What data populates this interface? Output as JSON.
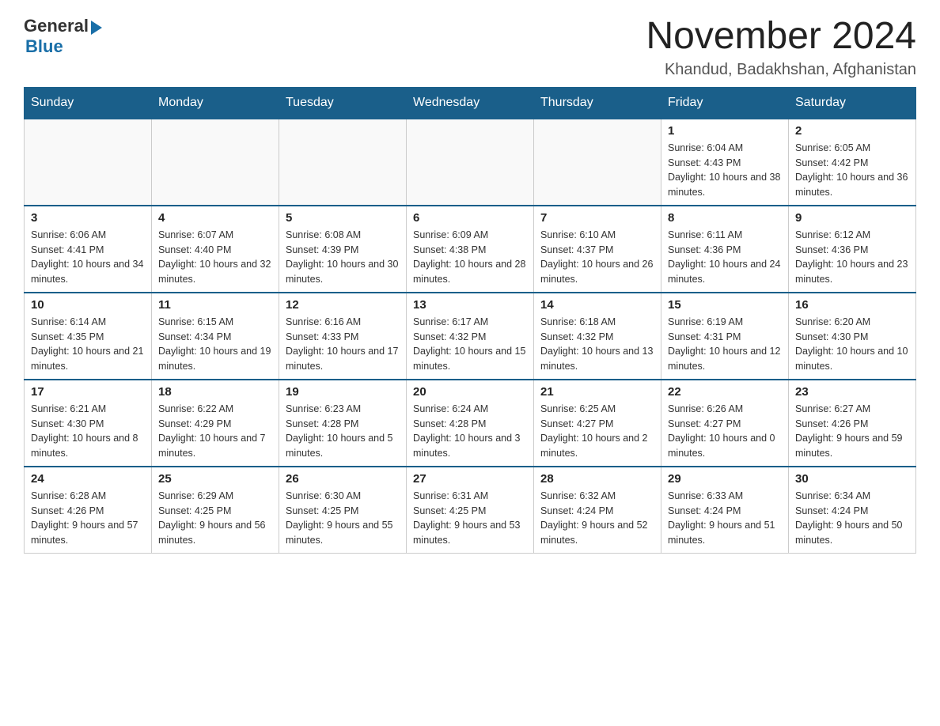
{
  "logo": {
    "general_text": "General",
    "blue_text": "Blue"
  },
  "title": "November 2024",
  "subtitle": "Khandud, Badakhshan, Afghanistan",
  "days_of_week": [
    "Sunday",
    "Monday",
    "Tuesday",
    "Wednesday",
    "Thursday",
    "Friday",
    "Saturday"
  ],
  "weeks": [
    {
      "days": [
        {
          "number": "",
          "info": ""
        },
        {
          "number": "",
          "info": ""
        },
        {
          "number": "",
          "info": ""
        },
        {
          "number": "",
          "info": ""
        },
        {
          "number": "",
          "info": ""
        },
        {
          "number": "1",
          "info": "Sunrise: 6:04 AM\nSunset: 4:43 PM\nDaylight: 10 hours and 38 minutes."
        },
        {
          "number": "2",
          "info": "Sunrise: 6:05 AM\nSunset: 4:42 PM\nDaylight: 10 hours and 36 minutes."
        }
      ]
    },
    {
      "days": [
        {
          "number": "3",
          "info": "Sunrise: 6:06 AM\nSunset: 4:41 PM\nDaylight: 10 hours and 34 minutes."
        },
        {
          "number": "4",
          "info": "Sunrise: 6:07 AM\nSunset: 4:40 PM\nDaylight: 10 hours and 32 minutes."
        },
        {
          "number": "5",
          "info": "Sunrise: 6:08 AM\nSunset: 4:39 PM\nDaylight: 10 hours and 30 minutes."
        },
        {
          "number": "6",
          "info": "Sunrise: 6:09 AM\nSunset: 4:38 PM\nDaylight: 10 hours and 28 minutes."
        },
        {
          "number": "7",
          "info": "Sunrise: 6:10 AM\nSunset: 4:37 PM\nDaylight: 10 hours and 26 minutes."
        },
        {
          "number": "8",
          "info": "Sunrise: 6:11 AM\nSunset: 4:36 PM\nDaylight: 10 hours and 24 minutes."
        },
        {
          "number": "9",
          "info": "Sunrise: 6:12 AM\nSunset: 4:36 PM\nDaylight: 10 hours and 23 minutes."
        }
      ]
    },
    {
      "days": [
        {
          "number": "10",
          "info": "Sunrise: 6:14 AM\nSunset: 4:35 PM\nDaylight: 10 hours and 21 minutes."
        },
        {
          "number": "11",
          "info": "Sunrise: 6:15 AM\nSunset: 4:34 PM\nDaylight: 10 hours and 19 minutes."
        },
        {
          "number": "12",
          "info": "Sunrise: 6:16 AM\nSunset: 4:33 PM\nDaylight: 10 hours and 17 minutes."
        },
        {
          "number": "13",
          "info": "Sunrise: 6:17 AM\nSunset: 4:32 PM\nDaylight: 10 hours and 15 minutes."
        },
        {
          "number": "14",
          "info": "Sunrise: 6:18 AM\nSunset: 4:32 PM\nDaylight: 10 hours and 13 minutes."
        },
        {
          "number": "15",
          "info": "Sunrise: 6:19 AM\nSunset: 4:31 PM\nDaylight: 10 hours and 12 minutes."
        },
        {
          "number": "16",
          "info": "Sunrise: 6:20 AM\nSunset: 4:30 PM\nDaylight: 10 hours and 10 minutes."
        }
      ]
    },
    {
      "days": [
        {
          "number": "17",
          "info": "Sunrise: 6:21 AM\nSunset: 4:30 PM\nDaylight: 10 hours and 8 minutes."
        },
        {
          "number": "18",
          "info": "Sunrise: 6:22 AM\nSunset: 4:29 PM\nDaylight: 10 hours and 7 minutes."
        },
        {
          "number": "19",
          "info": "Sunrise: 6:23 AM\nSunset: 4:28 PM\nDaylight: 10 hours and 5 minutes."
        },
        {
          "number": "20",
          "info": "Sunrise: 6:24 AM\nSunset: 4:28 PM\nDaylight: 10 hours and 3 minutes."
        },
        {
          "number": "21",
          "info": "Sunrise: 6:25 AM\nSunset: 4:27 PM\nDaylight: 10 hours and 2 minutes."
        },
        {
          "number": "22",
          "info": "Sunrise: 6:26 AM\nSunset: 4:27 PM\nDaylight: 10 hours and 0 minutes."
        },
        {
          "number": "23",
          "info": "Sunrise: 6:27 AM\nSunset: 4:26 PM\nDaylight: 9 hours and 59 minutes."
        }
      ]
    },
    {
      "days": [
        {
          "number": "24",
          "info": "Sunrise: 6:28 AM\nSunset: 4:26 PM\nDaylight: 9 hours and 57 minutes."
        },
        {
          "number": "25",
          "info": "Sunrise: 6:29 AM\nSunset: 4:25 PM\nDaylight: 9 hours and 56 minutes."
        },
        {
          "number": "26",
          "info": "Sunrise: 6:30 AM\nSunset: 4:25 PM\nDaylight: 9 hours and 55 minutes."
        },
        {
          "number": "27",
          "info": "Sunrise: 6:31 AM\nSunset: 4:25 PM\nDaylight: 9 hours and 53 minutes."
        },
        {
          "number": "28",
          "info": "Sunrise: 6:32 AM\nSunset: 4:24 PM\nDaylight: 9 hours and 52 minutes."
        },
        {
          "number": "29",
          "info": "Sunrise: 6:33 AM\nSunset: 4:24 PM\nDaylight: 9 hours and 51 minutes."
        },
        {
          "number": "30",
          "info": "Sunrise: 6:34 AM\nSunset: 4:24 PM\nDaylight: 9 hours and 50 minutes."
        }
      ]
    }
  ]
}
